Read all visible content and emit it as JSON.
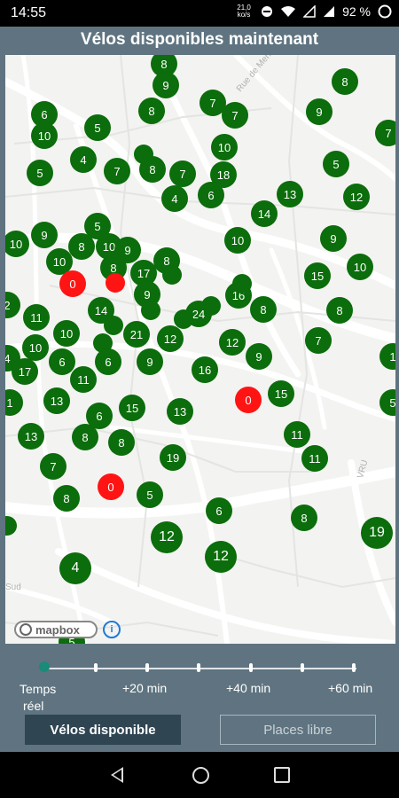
{
  "status": {
    "time": "14:55",
    "data_speed": "21,0",
    "data_unit": "ko/s",
    "battery": "92 %"
  },
  "title": "Vélos disponibles maintenant",
  "map": {
    "attribution": "mapbox",
    "info": "i",
    "streets": [
      "Rue de Menin",
      "VRU",
      "Sud"
    ],
    "markers": [
      "8",
      "9",
      "7",
      "7",
      "8",
      "9",
      "6",
      "10",
      "5",
      "8",
      "7",
      "4",
      "5",
      "7",
      "8",
      "10",
      "5",
      "7",
      "18",
      "13",
      "12",
      "6",
      "4",
      "14",
      "10",
      "9",
      "5",
      "10",
      "8",
      "10",
      "9",
      "9",
      "10",
      "15",
      "10",
      "8",
      "8",
      "17",
      "16",
      "0",
      "0",
      "9",
      "8",
      "2",
      "11",
      "14",
      "24",
      "8",
      "10",
      "21",
      "12",
      "12",
      "7",
      "6",
      "15",
      "4",
      "17",
      "11",
      "6",
      "16",
      "9",
      "7",
      "16",
      "1",
      "0",
      "15",
      "13",
      "6",
      "13",
      "13",
      "8",
      "8",
      "11",
      "11",
      "7",
      "19",
      "0",
      "5",
      "8",
      "6",
      "8",
      "12",
      "19",
      "4",
      "12",
      "5"
    ]
  },
  "slider": {
    "labels": [
      "Temps\nréel",
      "+20 min",
      "+40 min",
      "+60 min"
    ],
    "label_realtime": "Temps",
    "label_realtime2": "réel",
    "label_20": "+20 min",
    "label_40": "+40 min",
    "label_60": "+60 min",
    "value": "Temps réel"
  },
  "buttons": {
    "bikes": "Vélos disponible",
    "places": "Places libre"
  },
  "colors": {
    "available": "#0b6d0b",
    "empty": "#ff1414",
    "background": "#5f7480",
    "active_button": "#2f4552"
  }
}
